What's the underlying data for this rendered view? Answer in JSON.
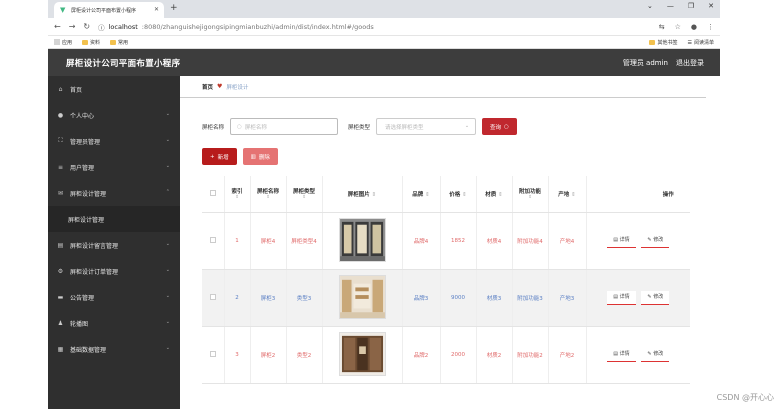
{
  "browser": {
    "tab_title": "屏柜设计公司平面布置小程序",
    "url_host": "localhost",
    "url_path": ":8080/zhanguishejigongsipingmianbuzhi/admin/dist/index.html#/goods",
    "bookmarks": [
      {
        "label": "应用"
      },
      {
        "label": "资料"
      },
      {
        "label": "常用"
      }
    ],
    "bookmarks_right": [
      {
        "label": "其他书签"
      },
      {
        "label": "阅读清单"
      }
    ]
  },
  "header": {
    "title": "屏柜设计公司平面布置小程序",
    "user": "管理员 admin",
    "logout": "退出登录"
  },
  "sidebar": {
    "items": [
      {
        "label": "首页",
        "icon": "home-icon",
        "glyph": "⌂"
      },
      {
        "label": "个人中心",
        "icon": "user-icon",
        "glyph": "●"
      },
      {
        "label": "管理员管理",
        "icon": "expand-icon",
        "glyph": "⛶"
      },
      {
        "label": "用户管理",
        "icon": "list-icon",
        "glyph": "≡"
      },
      {
        "label": "屏柜设计管理",
        "icon": "mail-icon",
        "glyph": "✉"
      },
      {
        "label": "屏柜设计管理",
        "icon": "",
        "glyph": ""
      },
      {
        "label": "屏柜设计留言管理",
        "icon": "doc-icon",
        "glyph": "▤"
      },
      {
        "label": "屏柜设计订单管理",
        "icon": "settings-icon",
        "glyph": "⚙"
      },
      {
        "label": "公告管理",
        "icon": "notice-icon",
        "glyph": "▬"
      },
      {
        "label": "轮播图",
        "icon": "person-icon",
        "glyph": "♟"
      },
      {
        "label": "基础数据管理",
        "icon": "data-icon",
        "glyph": "▦"
      }
    ]
  },
  "breadcrumb": {
    "home": "首页",
    "current": "屏柜设计"
  },
  "search": {
    "name_label": "屏柜名称",
    "name_placeholder": "屏柜名称",
    "type_label": "屏柜类型",
    "type_placeholder": "请选择屏柜类型",
    "query_button": "查询"
  },
  "actions": {
    "add": "新增",
    "delete": "删除"
  },
  "table": {
    "headers": [
      "索引",
      "屏柜名称",
      "屏柜类型",
      "屏柜图片",
      "品牌",
      "价格",
      "材质",
      "附加功能",
      "产地",
      "操作"
    ],
    "detail_label": "详情",
    "edit_label": "修改",
    "rows": [
      {
        "index": "1",
        "name": "屏柜4",
        "type": "屏柜类型4",
        "brand": "品牌4",
        "price": "1852",
        "material": "材质4",
        "extra": "附加功能4",
        "origin": "产地4",
        "color": "red"
      },
      {
        "index": "2",
        "name": "屏柜3",
        "type": "类型3",
        "brand": "品牌3",
        "price": "9000",
        "material": "材质3",
        "extra": "附加功能3",
        "origin": "产地3",
        "color": "blue"
      },
      {
        "index": "3",
        "name": "屏柜2",
        "type": "类型2",
        "brand": "品牌2",
        "price": "2000",
        "material": "材质2",
        "extra": "附加功能2",
        "origin": "产地2",
        "color": "red"
      }
    ]
  },
  "watermark": "CSDN @开心心"
}
